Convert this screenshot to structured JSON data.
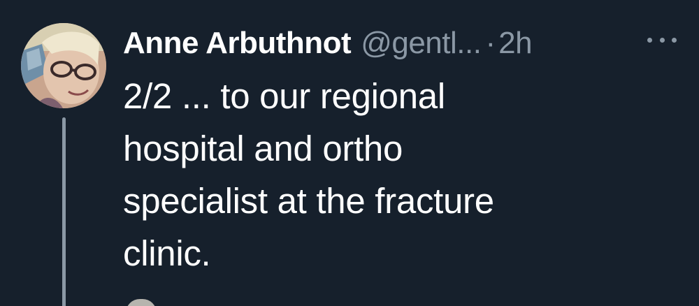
{
  "tweet": {
    "author_name": "Anne Arbuthnot",
    "handle": "@gentl...",
    "separator": "·",
    "timestamp": "2h",
    "more_icon": "more-horizontal-icon",
    "text_lines": [
      "2/2 ... to our regional",
      "hospital and ortho",
      "specialist at the fracture",
      "clinic."
    ]
  },
  "colors": {
    "background": "#16202c",
    "primary_text": "#ffffff",
    "secondary_text": "#8b98a5",
    "thread_line": "#8b98a5"
  }
}
